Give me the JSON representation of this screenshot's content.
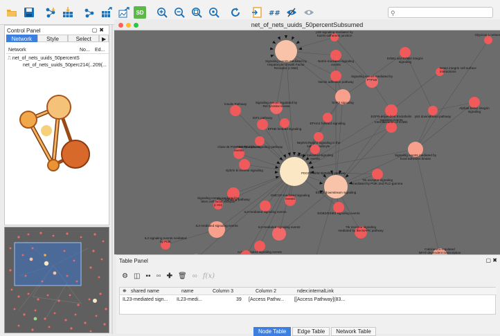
{
  "toolbar": {
    "icons": [
      "open-folder-icon",
      "save-icon",
      "import-network-icon",
      "import-table-icon",
      "export-network-icon",
      "export-table-icon",
      "export-image-icon",
      "sd-icon",
      "zoom-in-icon",
      "zoom-out-icon",
      "zoom-fit-icon",
      "zoom-selected-icon",
      "refresh-icon",
      "open-session-icon",
      "layout-icon",
      "hide-icon",
      "show-icon"
    ],
    "sd_label": "SD",
    "search_placeholder": ""
  },
  "control_panel": {
    "title": "Control Panel",
    "tabs": [
      "Network",
      "Style",
      "Select"
    ],
    "arrow": "▶",
    "col_network": "Network",
    "col_nodes": "No...",
    "col_edges": "Ed...",
    "root": "net_of_nets_uuids_50percentS",
    "child": "net_of_nets_uuids_50perc214(...",
    "child_nodes": "209(..."
  },
  "network_window": {
    "title": "net_of_nets_uuids_50percentSubsumed",
    "dot_colors": [
      "#ff5f57",
      "#febc2e",
      "#28c840"
    ]
  },
  "graph": {
    "labels": [
      "Signaling events mediated by Hepatocyte Growth Factor Receptor (c-Met)",
      "Netrin-mediated signaling events",
      "p38 signaling mediated by Kazrin-adherens junction",
      "ErbB1 and ErbB4 integrin signaling",
      "Glypican 1 network",
      "Beta1 integrin cell surface interactions",
      "Alpha6 beta1 integrin signaling",
      "Nectin adhesion pathway",
      "Signaling events mediated by PTP1B",
      "SHP2 signaling",
      "EGFR-dependent Endothelin signaling events",
      "p53 downstream pathway",
      "Signaling events regulated by Ret tyrosine kinase",
      "Insulin Pathway",
      "EPHA2 forward signaling",
      "EPHB forward signaling",
      "IGF1 pathway",
      "Internalization of ErbB1",
      "Nephrin/Neph1 signaling in the kidney podocyte",
      "PDGFR-alpha signaling pathway",
      "Netrin-mediated signaling events",
      "Signaling events mediated by focal adhesion kinase",
      "Class IB PI3K non-lipid kinase events",
      "Ephrin B reverse signaling",
      "PDGFR-beta signaling pathway",
      "Trk receptor signaling mediated by PI3K and PLC-gamma",
      "ErbB2 downstream signaling",
      "EPO signaling pathway",
      "Signaling events mediated by Stem cell factor receptor (c-Kit)",
      "IL3-mediated signaling events",
      "GMCSF-mediated signaling events",
      "ErbB2/ErbB3 signaling events",
      "IL4-mediated signaling events",
      "IL2-mediated signaling events",
      "Trk receptor signaling mediated by the MAPK pathway",
      "IL23-mediated signaling events",
      "IL5-mediated signaling events",
      "IL2 signaling events mediated by STAT5",
      "IL2 signaling events mediated by PI3K",
      "Ras signaling in the CD4+ TCR pathway",
      "Calcineurin-regulated NFAT-dependent transcription in lymphocytes"
    ]
  },
  "table_panel": {
    "title": "Table Panel",
    "formula_label": "f(x)",
    "columns": [
      "shared name",
      "name",
      "Column 3",
      "Column 2",
      "ndex:internalLink"
    ],
    "rows": [
      [
        "IL23-mediated sign...",
        "IL23-medi...",
        "39",
        "[Access Pathw...",
        "[[Access Pathway](83..."
      ]
    ],
    "bottom_tabs": [
      "Node Table",
      "Edge Table",
      "Network Table"
    ]
  }
}
